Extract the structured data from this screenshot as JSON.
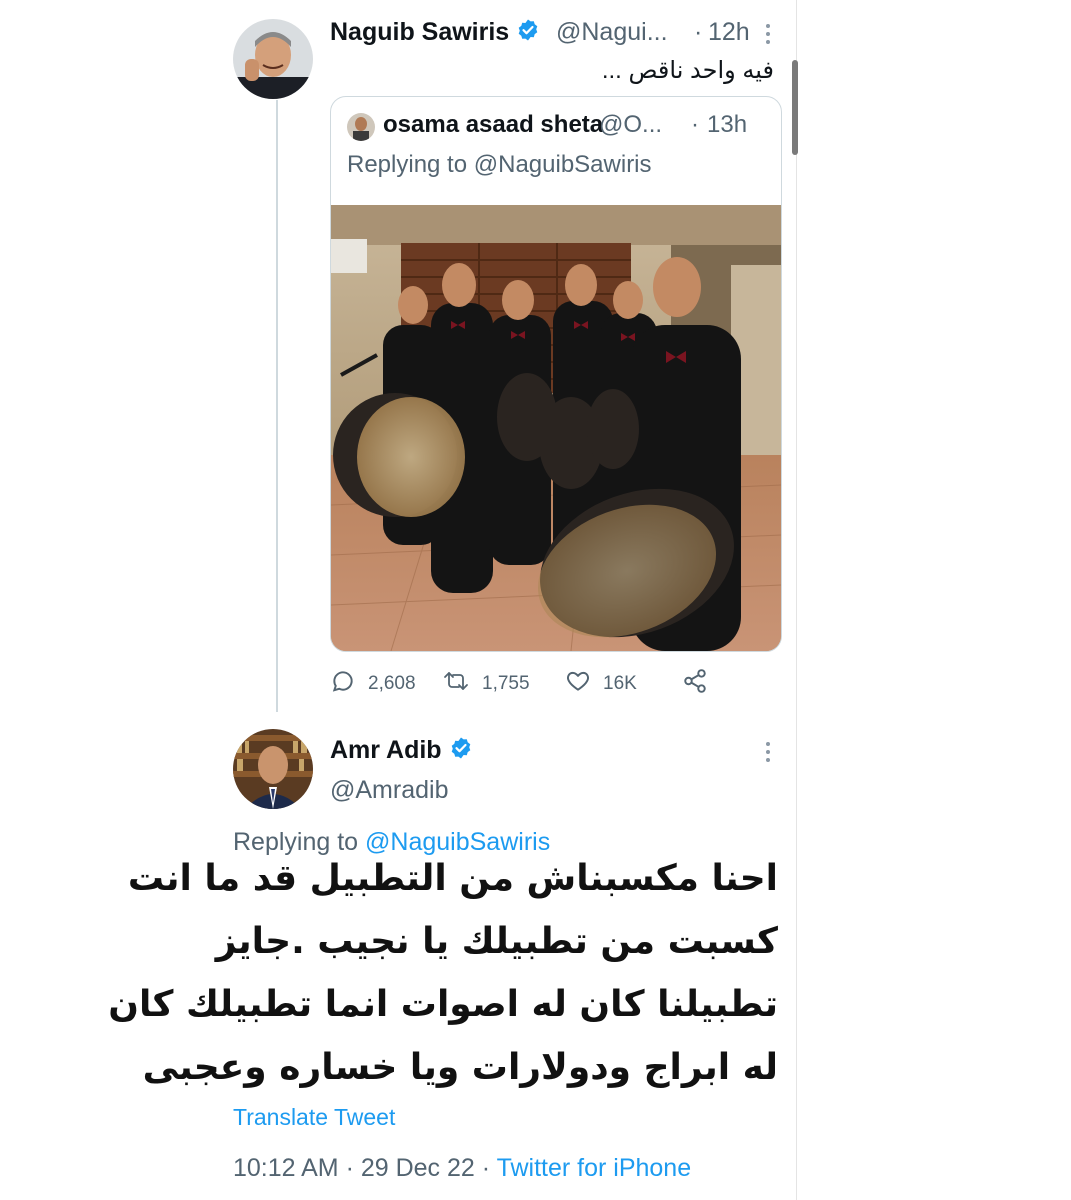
{
  "colors": {
    "link": "#1d9bf0",
    "muted": "#536471",
    "verified": "#1d9bf0",
    "border": "#cfd9de"
  },
  "tweet1": {
    "author_name": "Naguib Sawiris",
    "author_handle": "@Nagui...",
    "separator": "·",
    "time": "12h",
    "verified_icon": "verified-badge-icon",
    "more_icon": "more-vertical-icon",
    "text": "فيه واحد ناقص ..."
  },
  "quoted": {
    "author_name": "osama asaad sheta",
    "author_handle": "@O...",
    "separator": "·",
    "time": "13h",
    "replying_prefix": "Replying to",
    "replying_handle": "@NaguibSawiris",
    "photo_icon": "drummers-photo"
  },
  "actions": {
    "reply_icon": "reply-icon",
    "reply_count": "2,608",
    "retweet_icon": "retweet-icon",
    "retweet_count": "1,755",
    "like_icon": "heart-icon",
    "like_count": "16K",
    "share_icon": "share-icon"
  },
  "tweet2": {
    "author_name": "Amr Adib",
    "author_handle": "@Amradib",
    "verified_icon": "verified-badge-icon",
    "more_icon": "more-vertical-icon",
    "replying_prefix": "Replying to",
    "replying_handle": "@NaguibSawiris",
    "lines": [
      "احنا مكسبناش من التطبيل قد ما انت",
      "كسبت من تطبيلك يا نجيب .جايز",
      "تطبيلنا كان له اصوات انما تطبيلك كان",
      "له ابراج ودولارات ويا خساره وعجبى"
    ],
    "translate_label": "Translate Tweet",
    "timestamp": "10:12 AM · 29 Dec 22 · ",
    "source": "Twitter for iPhone"
  }
}
